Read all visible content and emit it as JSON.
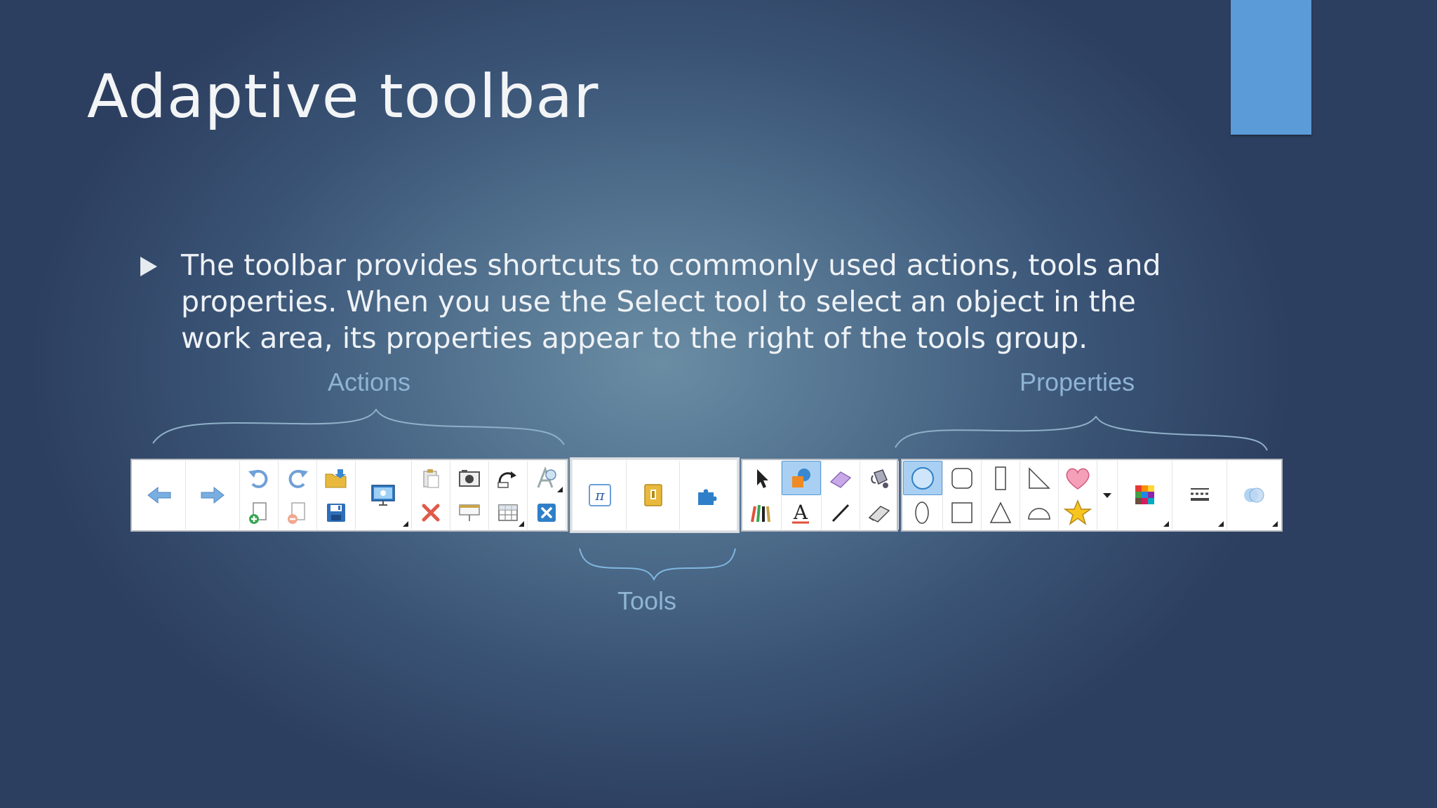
{
  "slide": {
    "title": "Adaptive toolbar",
    "bullet": "The toolbar provides shortcuts to commonly used actions, tools and properties. When you use the Select tool to select an object in the work area, its properties appear to the   right of the tools group."
  },
  "labels": {
    "actions": "Actions",
    "tools": "Tools",
    "properties": "Properties"
  },
  "colors": {
    "accent": "#5b9bd8",
    "label": "#8fb4d4",
    "selected_tool_bg": "#a9d0f2"
  },
  "toolbar": {
    "actions_icons": [
      "back-arrow-icon",
      "forward-arrow-icon",
      "undo-icon",
      "redo-icon",
      "add-page-icon",
      "delete-page-icon",
      "open-file-icon",
      "save-icon",
      "display-screen-icon",
      "paste-icon",
      "delete-icon",
      "screen-capture-icon",
      "screen-shade-icon",
      "full-screen-icon",
      "insert-table-icon",
      "document-camera-icon",
      "close-icon"
    ],
    "tools_icons": [
      "math-tools-icon",
      "add-on-icon",
      "puzzle-piece-icon"
    ],
    "select_icons": [
      "select-arrow-icon",
      "shapes-icon",
      "eraser-icon",
      "fill-icon",
      "pens-icon",
      "text-icon",
      "line-icon",
      "magic-eraser-icon"
    ],
    "properties_icons": [
      "circle-shape-icon",
      "rounded-rect-shape-icon",
      "tall-rect-shape-icon",
      "right-triangle-shape-icon",
      "heart-shape-icon",
      "ellipse-shape-icon",
      "square-shape-icon",
      "triangle-shape-icon",
      "semicircle-shape-icon",
      "star-shape-icon",
      "more-shapes-dropdown-icon",
      "color-palette-icon",
      "line-style-icon",
      "transparency-icon"
    ]
  }
}
